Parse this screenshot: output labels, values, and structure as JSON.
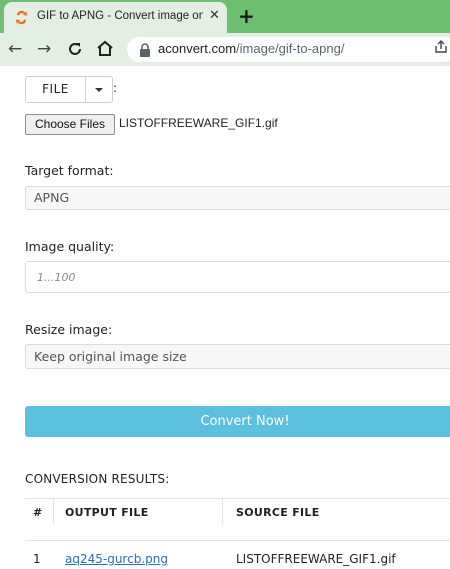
{
  "browser": {
    "tab_title": "GIF to APNG - Convert image online",
    "url_domain": "aconvert.com",
    "url_path": "/image/gif-to-apng/",
    "colors": {
      "tabstrip": "#6fbf73",
      "toolbar": "#e3efe2"
    }
  },
  "page": {
    "file_button_label": "FILE",
    "colon": ":",
    "choose_files_label": "Choose Files",
    "selected_file": "LISTOFFREEWARE_GIF1.gif",
    "target_format_label": "Target format:",
    "target_format_value": "APNG",
    "image_quality_label": "Image quality:",
    "image_quality_placeholder": "1...100",
    "resize_label": "Resize image:",
    "resize_value": "Keep original image size",
    "convert_button_label": "Convert Now!",
    "colors": {
      "convert_button": "#5bc0de",
      "link": "#2a6ebb"
    }
  },
  "results": {
    "title": "CONVERSION RESULTS:",
    "headers": [
      "#",
      "OUTPUT FILE",
      "SOURCE FILE"
    ],
    "rows": [
      {
        "num": "1",
        "output": "aq245-gurcb.png",
        "source": "LISTOFFREEWARE_GIF1.gif"
      }
    ]
  }
}
